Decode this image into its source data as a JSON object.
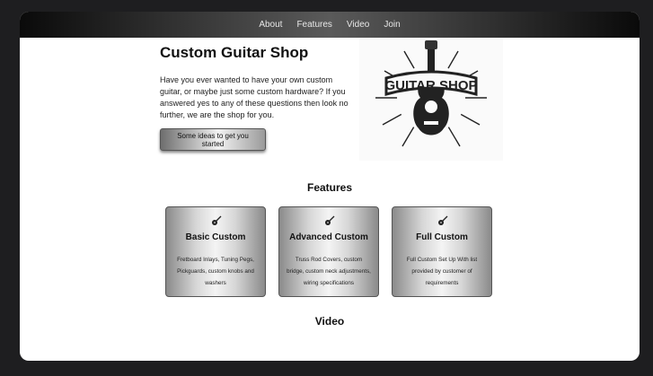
{
  "nav": {
    "items": [
      {
        "label": "About"
      },
      {
        "label": "Features"
      },
      {
        "label": "Video"
      },
      {
        "label": "Join"
      }
    ]
  },
  "hero": {
    "title": "Custom Guitar Shop",
    "text": "Have you ever wanted to have your own custom guitar, or maybe just some custom hardware? If you answered yes to any of these questions then look no further, we are the shop for you.",
    "button_label": "Some ideas to get you started"
  },
  "logo": {
    "text": "GUITAR SHOP",
    "icon": "guitar-icon"
  },
  "features": {
    "title": "Features",
    "cards": [
      {
        "icon": "guitar-icon",
        "title": "Basic Custom",
        "text": "Fretboard Inlays, Tuning Pegs, Pickguards, custom knobs and washers"
      },
      {
        "icon": "guitar-icon",
        "title": "Advanced Custom",
        "text": "Truss Rod Covers, custom bridge, custom neck adjustments, wiring specifications"
      },
      {
        "icon": "guitar-icon",
        "title": "Full Custom",
        "text": "Full Custom Set Up With list provided by customer of requirements"
      }
    ]
  },
  "video": {
    "title": "Video"
  },
  "colors": {
    "background": "#1e1e20",
    "page": "#ffffff",
    "text": "#111111"
  }
}
